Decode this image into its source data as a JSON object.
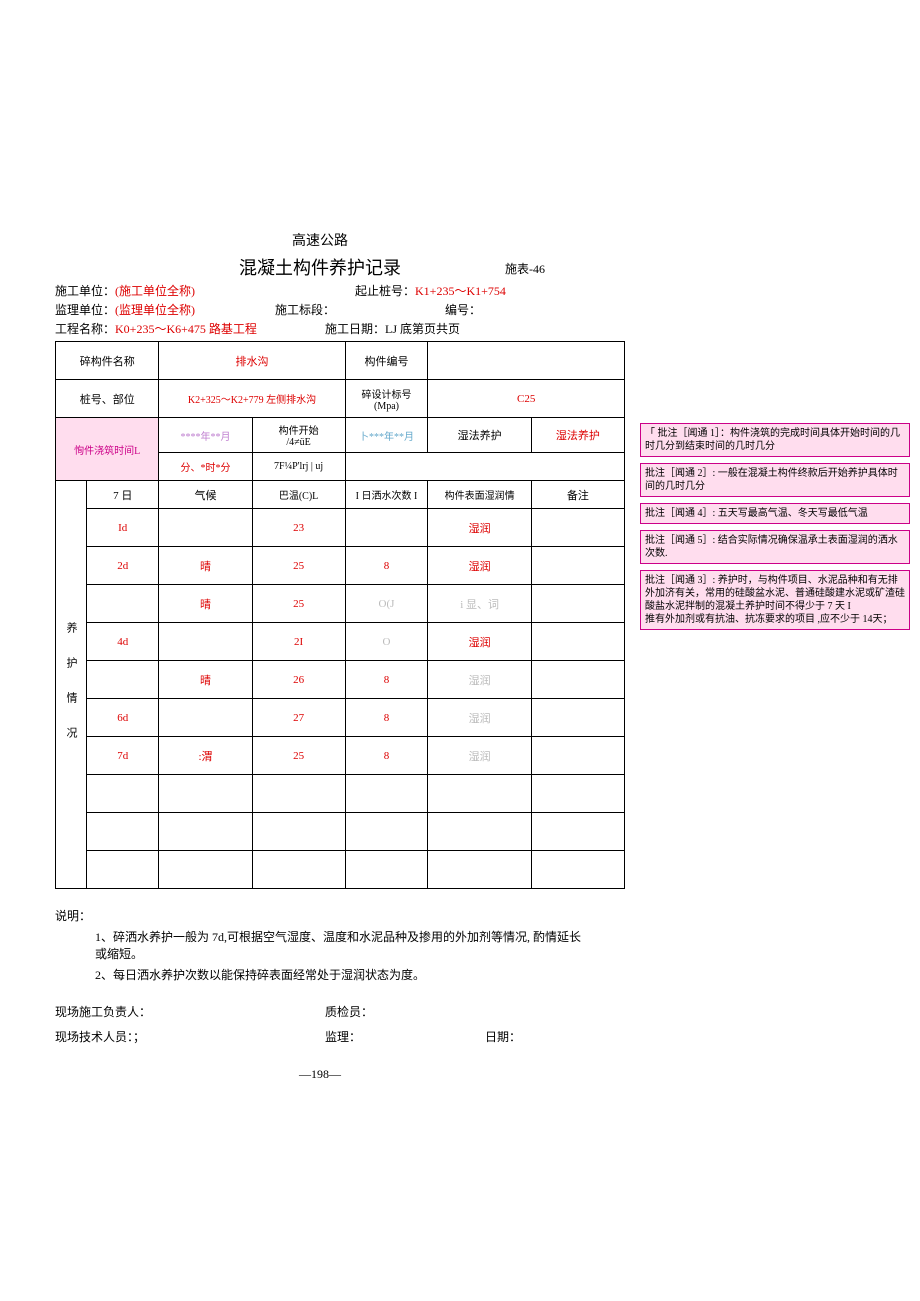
{
  "header": {
    "title1": "高速公路",
    "title2": "混凝土构件养护记录",
    "formno": "施表-46"
  },
  "meta": {
    "sg_label": "施工单位：",
    "sg_value": "(施工单位全称)",
    "qz_label": "起止桩号：",
    "qz_value": "K1+235～K1+754",
    "jl_label": "监理单位：",
    "jl_value": "(监理单位全称)",
    "bd_label": "施工标段：",
    "bh_label": "编号：",
    "gc_label": "工程名称：",
    "gc_value": "K0+235～K6+475 路基工程",
    "rq_label": "施工日期：",
    "rq_value": "LJ 底第页共页"
  },
  "thead": {
    "name_l": "碎构件名称",
    "name_v": "排水沟",
    "code_l": "构件编号",
    "code_v": "",
    "pos_l": "桩号、部位",
    "pos_v": "K2+325～K2+779 左侧排水沟",
    "des_l": "碎设计标号\n(Mpa)",
    "des_v": "C25",
    "cast_l": "恂件浇筑时间L",
    "cast_v1": "****年**月",
    "cast_s": "构件开始\n/4≠üE",
    "cast_v2": "卜***年**月",
    "wet_l": "湿法养护",
    "wet_v": "湿法养护",
    "fen": "分、*时*分",
    "garb": "7F¼P'lrj | uj",
    "d7": "7 日",
    "qh": "气候",
    "wen": "巴温(C)L",
    "sprays": "I 日洒水次数 I",
    "surface": "构件表面湿润情",
    "bei": "备注"
  },
  "side_label": "养 护 情 况",
  "rows": [
    {
      "d": "Id",
      "w": "",
      "t": "23",
      "s": "",
      "m": "湿润"
    },
    {
      "d": "2d",
      "w": "晴",
      "t": "25",
      "s": "8",
      "m": "湿润"
    },
    {
      "d": "",
      "w": "晴",
      "t": "25",
      "s": "O(J",
      "m": "i 显、词"
    },
    {
      "d": "4d",
      "w": "",
      "t": "2I",
      "s": "O",
      "m": "湿润"
    },
    {
      "d": "",
      "w": "晴",
      "t": "26",
      "s": "8",
      "m": "湿润"
    },
    {
      "d": "6d",
      "w": "",
      "t": "27",
      "s": "8",
      "m": "湿润"
    },
    {
      "d": "7d",
      "w": ":渭",
      "t": "25",
      "s": "8",
      "m": "湿润"
    },
    {
      "d": "",
      "w": "",
      "t": "",
      "s": "",
      "m": ""
    },
    {
      "d": "",
      "w": "",
      "t": "",
      "s": "",
      "m": ""
    },
    {
      "d": "",
      "w": "",
      "t": "",
      "s": "",
      "m": ""
    }
  ],
  "notes": {
    "shuo": "说明：",
    "n1": "1、碎洒水养护一般为 7d,可根据空气湿度、温度和水泥品种及掺用的外加剂等情况, 酌情延长或缩短。",
    "n2": "2、每日洒水养护次数以能保持碎表面经常处于湿润状态为度。"
  },
  "sigs": {
    "a": "现场施工负责人：",
    "b": "质检员：",
    "c": "现场技术人员：；",
    "d": "监理：",
    "e": "日期："
  },
  "pgnum": "—198—",
  "comments": [
    "「  批注［闻通 1］：构件浇筑的完成时间具体开始时间的几时几分到结束时间的几时几分",
    "批注［闻通 2］: 一般在混凝土构件终款后开始养护具体时间的几时几分",
    "批注［闻通 4］: 五天写最高气温、冬天写最低气温",
    "批注［闻通 5］: 结合实际情况确保温承土表面湿润的洒水次数.",
    "批注［闻通 3］: 养护时，与构件项目、水泥品种和有无排外加济有关，常用的硅酸盆水泥、普通硅酸建水泥或矿渣硅酸盐水泥拌制的混凝土养护时间不得少于 7 天 I\n推有外加剂或有抗油、抗冻要求的项目 ,应不少于 14天；"
  ]
}
